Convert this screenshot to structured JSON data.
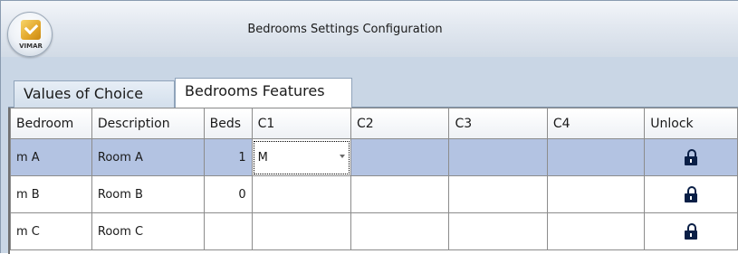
{
  "window": {
    "title": "Bedrooms Settings Configuration"
  },
  "logo": {
    "brand": "VIMAR"
  },
  "tabs": [
    {
      "label": "Values of Choice",
      "active": false
    },
    {
      "label": "Bedrooms Features",
      "active": true
    }
  ],
  "table": {
    "columns": [
      "Bedroom",
      "Description",
      "Beds",
      "C1",
      "C2",
      "C3",
      "C4",
      "Unlock"
    ],
    "rows": [
      {
        "bedroom": "m A",
        "description": "Room A",
        "beds": "1",
        "c1": "M",
        "c2": "",
        "c3": "",
        "c4": "",
        "unlock_icon": "unlock-icon",
        "selected": true
      },
      {
        "bedroom": "m B",
        "description": "Room B",
        "beds": "0",
        "c1": "",
        "c2": "",
        "c3": "",
        "c4": "",
        "unlock_icon": "unlock-icon",
        "selected": false
      },
      {
        "bedroom": "m C",
        "description": "Room C",
        "beds": "",
        "c1": "",
        "c2": "",
        "c3": "",
        "c4": "",
        "unlock_icon": "unlock-icon",
        "selected": false
      }
    ]
  },
  "colors": {
    "selected_row": "#b3c3e2",
    "lock_icon": "#0a1f46",
    "window_frame": "#c9d6e5"
  }
}
